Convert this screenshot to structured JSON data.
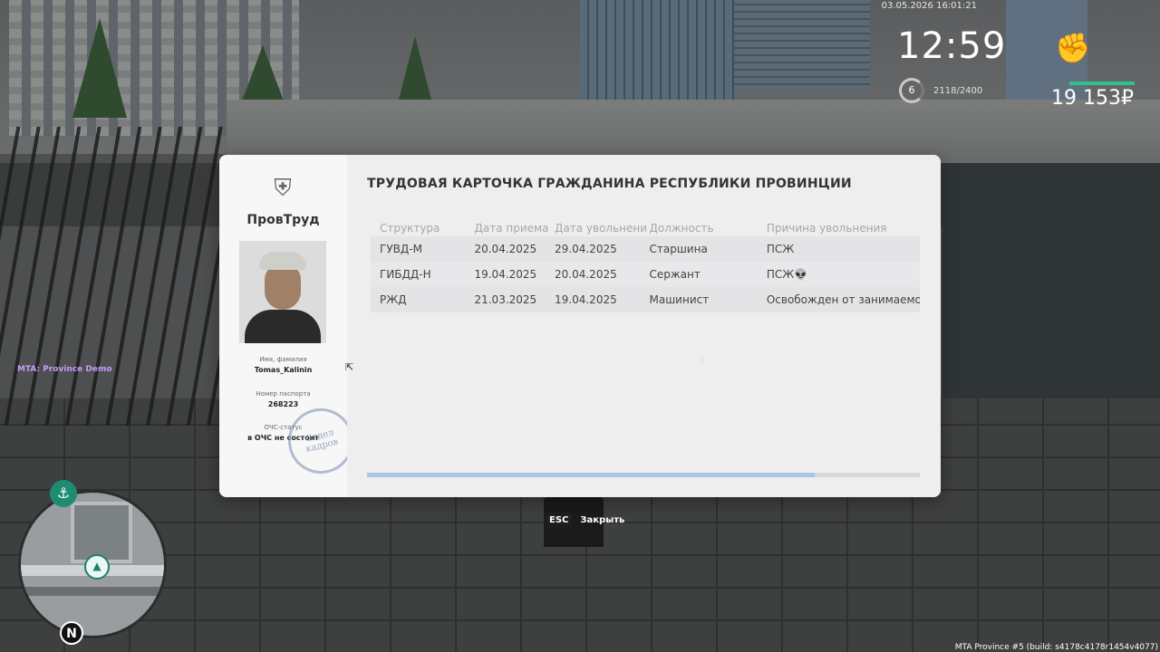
{
  "hud": {
    "datetime": "03.05.2026 16:01:21",
    "time": "12:59",
    "level": "6",
    "experience": "2118/2400",
    "money": "19 153₽",
    "fist_icon": "fist-icon"
  },
  "server_label": "MTA: Province Demo",
  "build_label": "MTA Province #5 (build: s4178c4178r1454v4077)",
  "minimap": {
    "north": "N"
  },
  "card": {
    "brand": "ПровТруд",
    "title": "ТРУДОВАЯ КАРТОЧКА ГРАЖДАНИНА РЕСПУБЛИКИ ПРОВИНЦИИ",
    "name_caption": "Имя, фамилия",
    "name": "Tomas_Kalinin",
    "passport_caption": "Номер паспорта",
    "passport": "268223",
    "ochs_caption": "ОЧС-статус",
    "ochs": "в ОЧС не состоит",
    "stamp_text": "Отдел кадров",
    "columns": [
      "Структура",
      "Дата приема",
      "Дата увольнени",
      "Должность",
      "Причина увольнения"
    ],
    "rows": [
      [
        "ГУВД-М",
        "20.04.2025",
        "29.04.2025",
        "Старшина",
        "ПСЖ"
      ],
      [
        "ГИБДД-Н",
        "19.04.2025",
        "20.04.2025",
        "Сержант",
        "ПСЖ👽"
      ],
      [
        "РЖД",
        "21.03.2025",
        "19.04.2025",
        "Машинист",
        "Освобожден от занимаемой"
      ]
    ],
    "scroll_progress": 0.81
  },
  "esc_hint": {
    "key": "ESC",
    "label": "Закрыть"
  },
  "colors": {
    "accent": "#2ec28a",
    "progress": "#a9c5e6"
  }
}
